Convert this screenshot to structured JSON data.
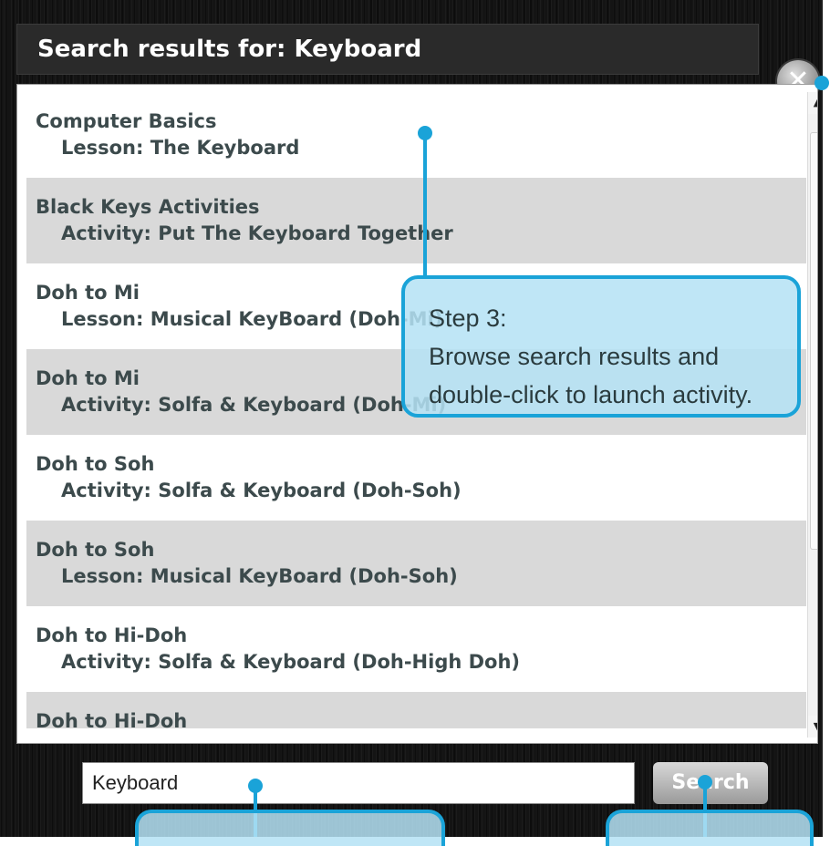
{
  "header": {
    "title": "Search results for: Keyboard"
  },
  "close_button": {
    "icon": "close-icon",
    "glyph": "✕"
  },
  "results": [
    {
      "title": "Computer Basics",
      "subtitle": "Lesson: The Keyboard"
    },
    {
      "title": "Black Keys Activities",
      "subtitle": "Activity: Put The Keyboard Together"
    },
    {
      "title": "Doh to Mi",
      "subtitle": "Lesson: Musical KeyBoard (Doh-Mi)"
    },
    {
      "title": "Doh to Mi",
      "subtitle": "Activity: Solfa & Keyboard (Doh-Mi)"
    },
    {
      "title": "Doh to Soh",
      "subtitle": "Activity: Solfa & Keyboard (Doh-Soh)"
    },
    {
      "title": "Doh to Soh",
      "subtitle": "Lesson: Musical KeyBoard (Doh-Soh)"
    },
    {
      "title": "Doh to Hi-Doh",
      "subtitle": "Activity: Solfa & Keyboard (Doh-High Doh)"
    },
    {
      "title": "Doh to Hi-Doh",
      "subtitle": ""
    }
  ],
  "scrollbar": {
    "up_icon": "scroll-up-icon",
    "down_icon": "scroll-down-icon"
  },
  "search": {
    "value": "Keyboard",
    "button_label": "Search"
  },
  "annotations": {
    "step3_title": "Step 3:",
    "step3_line1": "Browse search results and",
    "step3_line2": "double-click to launch activity."
  },
  "colors": {
    "accent": "#1aa3d8",
    "row_alt": "#d9d9d9",
    "text": "#3c4a4c"
  }
}
